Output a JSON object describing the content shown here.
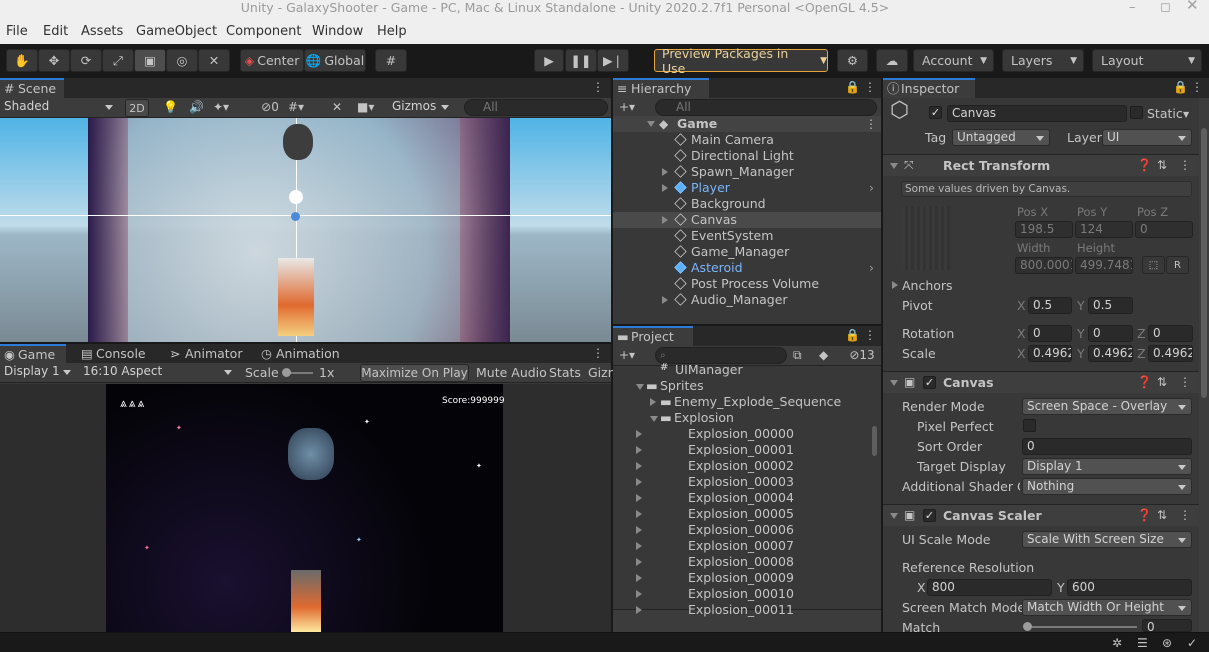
{
  "window": {
    "title": "Unity - GalaxyShooter - Game - PC, Mac & Linux Standalone - Unity 2020.2.7f1 Personal <OpenGL 4.5>"
  },
  "menu": [
    "File",
    "Edit",
    "Assets",
    "GameObject",
    "Component",
    "Window",
    "Help"
  ],
  "toolbar": {
    "pivot": "Center",
    "space": "Global",
    "preview_packages": "Preview Packages in Use",
    "account": "Account",
    "layers": "Layers",
    "layout": "Layout"
  },
  "scene": {
    "tab": "Scene",
    "shading": "Shaded",
    "mode_2d": "2D",
    "hidden_count": "0",
    "gizmos": "Gizmos",
    "search_placeholder": "All"
  },
  "game": {
    "tabs": [
      "Game",
      "Console",
      "Animator",
      "Animation"
    ],
    "display": "Display 1",
    "aspect": "16:10 Aspect",
    "scale_label": "Scale",
    "scale_value": "1x",
    "maximize": "Maximize On Play",
    "mute": "Mute Audio",
    "stats": "Stats",
    "gizmos": "Gizr",
    "score": "Score:999999"
  },
  "hierarchy": {
    "tab": "Hierarchy",
    "search_placeholder": "All",
    "scene": "Game",
    "items": [
      {
        "name": "Main Camera",
        "arrow": false,
        "prefab": false
      },
      {
        "name": "Directional Light",
        "arrow": false,
        "prefab": false
      },
      {
        "name": "Spawn_Manager",
        "arrow": true,
        "prefab": false
      },
      {
        "name": "Player",
        "arrow": true,
        "prefab": true
      },
      {
        "name": "Background",
        "arrow": false,
        "prefab": false
      },
      {
        "name": "Canvas",
        "arrow": true,
        "prefab": false,
        "selected": true
      },
      {
        "name": "EventSystem",
        "arrow": false,
        "prefab": false
      },
      {
        "name": "Game_Manager",
        "arrow": false,
        "prefab": false
      },
      {
        "name": "Asteroid",
        "arrow": false,
        "prefab": true
      },
      {
        "name": "Post Process Volume",
        "arrow": false,
        "prefab": false
      },
      {
        "name": "Audio_Manager",
        "arrow": true,
        "prefab": false
      }
    ]
  },
  "project": {
    "tab": "Project",
    "hidden_count": "13",
    "items": [
      {
        "name": "UIManager",
        "depth": 0
      },
      {
        "name": "Sprites",
        "depth": 0
      },
      {
        "name": "Enemy_Explode_Sequence",
        "depth": 1
      },
      {
        "name": "Explosion",
        "depth": 1
      },
      {
        "name": "Explosion_00000",
        "depth": 2
      },
      {
        "name": "Explosion_00001",
        "depth": 2
      },
      {
        "name": "Explosion_00002",
        "depth": 2
      },
      {
        "name": "Explosion_00003",
        "depth": 2
      },
      {
        "name": "Explosion_00004",
        "depth": 2
      },
      {
        "name": "Explosion_00005",
        "depth": 2
      },
      {
        "name": "Explosion_00006",
        "depth": 2
      },
      {
        "name": "Explosion_00007",
        "depth": 2
      },
      {
        "name": "Explosion_00008",
        "depth": 2
      },
      {
        "name": "Explosion_00009",
        "depth": 2
      },
      {
        "name": "Explosion_00010",
        "depth": 2
      },
      {
        "name": "Explosion_00011",
        "depth": 2
      }
    ]
  },
  "inspector": {
    "tab": "Inspector",
    "object_name": "Canvas",
    "static": "Static",
    "tag_label": "Tag",
    "tag": "Untagged",
    "layer_label": "Layer",
    "layer": "UI",
    "rect": {
      "title": "Rect Transform",
      "note": "Some values driven by Canvas.",
      "posx_label": "Pos X",
      "posy_label": "Pos Y",
      "posz_label": "Pos Z",
      "posx": "198.5",
      "posy": "124",
      "posz": "0",
      "width_label": "Width",
      "height_label": "Height",
      "width": "800.0001",
      "height": "499.7481",
      "r_button": "R",
      "anchors": "Anchors",
      "pivot": "Pivot",
      "pivot_x": "0.5",
      "pivot_y": "0.5",
      "rotation": "Rotation",
      "rot_x": "0",
      "rot_y": "0",
      "rot_z": "0",
      "scale": "Scale",
      "scale_x": "0.4962",
      "scale_y": "0.4962",
      "scale_z": "0.4962",
      "x": "X",
      "y": "Y",
      "z": "Z"
    },
    "canvas": {
      "title": "Canvas",
      "render_mode_label": "Render Mode",
      "render_mode": "Screen Space - Overlay",
      "pixel_perfect": "Pixel Perfect",
      "sort_order_label": "Sort Order",
      "sort_order": "0",
      "target_display_label": "Target Display",
      "target_display": "Display 1",
      "shader_label": "Additional Shader Ch",
      "shader": "Nothing"
    },
    "scaler": {
      "title": "Canvas Scaler",
      "ui_scale_label": "UI Scale Mode",
      "ui_scale": "Scale With Screen Size",
      "ref_res_label": "Reference Resolution",
      "ref_x": "800",
      "ref_y": "600",
      "match_mode_label": "Screen Match Mode",
      "match_mode": "Match Width Or Height",
      "match_label": "Match",
      "match_value": "0"
    }
  }
}
